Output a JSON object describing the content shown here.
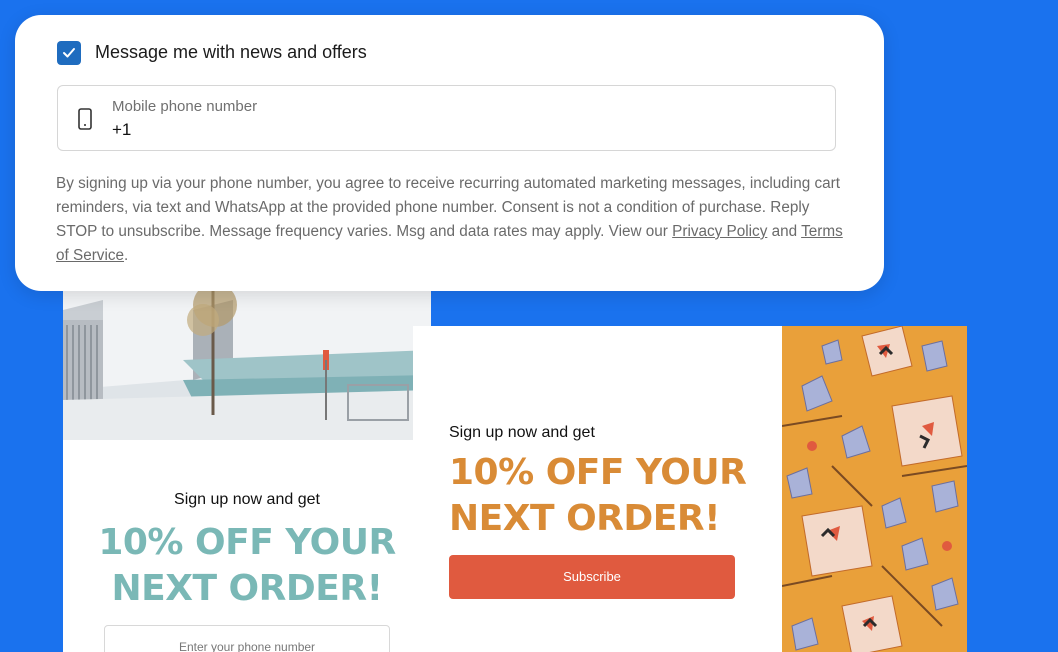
{
  "form": {
    "checkbox_label": "Message me with news and offers",
    "checkbox_checked": true,
    "phone_label": "Mobile phone number",
    "phone_value": "+1",
    "consent_text": "By signing up via your phone number, you agree to receive recurring automated marketing messages, including cart reminders, via text and WhatsApp at the provided phone number. Consent is not a condition of purchase. Reply STOP to unsubscribe. Message frequency varies. Msg and data rates may apply. View our ",
    "privacy_link": "Privacy Policy",
    "and_text": " and ",
    "terms_link": "Terms of Service",
    "end_text": "."
  },
  "popup_left": {
    "subheading": "Sign up now and get",
    "headline_line1": "10% OFF YOUR",
    "headline_line2": "NEXT ORDER!",
    "input_placeholder": "Enter your phone number",
    "headline_color": "#7ab8b6"
  },
  "popup_right": {
    "subheading": "Sign up now and get",
    "headline_line1": "10% OFF YOUR",
    "headline_line2": "NEXT ORDER!",
    "button_label": "Subscribe",
    "headline_color": "#d98b36",
    "button_color": "#e05a3f"
  },
  "colors": {
    "background": "#1a72ee",
    "checkbox": "#1f6cbf"
  }
}
